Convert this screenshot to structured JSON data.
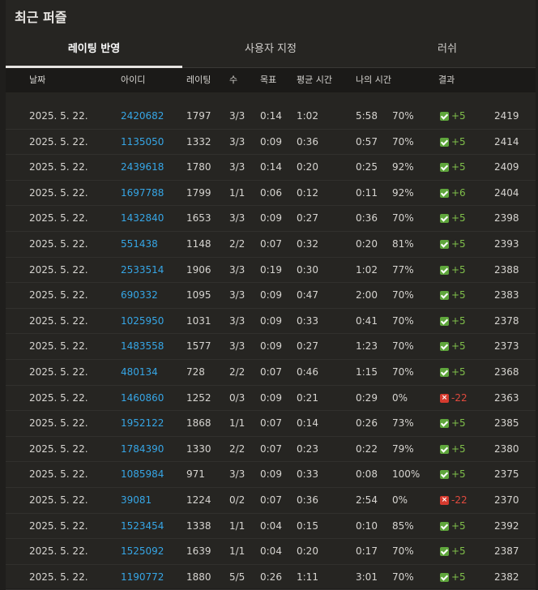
{
  "page": {
    "title": "최근 퍼즐"
  },
  "tabs": [
    {
      "label": "레이팅 반영",
      "active": true
    },
    {
      "label": "사용자 지정",
      "active": false
    },
    {
      "label": "러쉬",
      "active": false
    }
  ],
  "columns": [
    "날짜",
    "아이디",
    "레이팅",
    "수",
    "목표",
    "평균 시간",
    "나의 시간",
    "결과"
  ],
  "colors": {
    "success": "#5fa63c",
    "fail": "#d63b2f",
    "link": "#36a6e6"
  },
  "rows": [
    {
      "date": "2025. 5. 22.",
      "id": "2420682",
      "rating": "1797",
      "moves": "3/3",
      "goal": "0:14",
      "avg": "1:02",
      "mine": "5:58",
      "accuracy": "70%",
      "passed": true,
      "delta": "+5",
      "score": "2419"
    },
    {
      "date": "2025. 5. 22.",
      "id": "1135050",
      "rating": "1332",
      "moves": "3/3",
      "goal": "0:09",
      "avg": "0:36",
      "mine": "0:57",
      "accuracy": "70%",
      "passed": true,
      "delta": "+5",
      "score": "2414"
    },
    {
      "date": "2025. 5. 22.",
      "id": "2439618",
      "rating": "1780",
      "moves": "3/3",
      "goal": "0:14",
      "avg": "0:20",
      "mine": "0:25",
      "accuracy": "92%",
      "passed": true,
      "delta": "+5",
      "score": "2409"
    },
    {
      "date": "2025. 5. 22.",
      "id": "1697788",
      "rating": "1799",
      "moves": "1/1",
      "goal": "0:06",
      "avg": "0:12",
      "mine": "0:11",
      "accuracy": "92%",
      "passed": true,
      "delta": "+6",
      "score": "2404"
    },
    {
      "date": "2025. 5. 22.",
      "id": "1432840",
      "rating": "1653",
      "moves": "3/3",
      "goal": "0:09",
      "avg": "0:27",
      "mine": "0:36",
      "accuracy": "70%",
      "passed": true,
      "delta": "+5",
      "score": "2398"
    },
    {
      "date": "2025. 5. 22.",
      "id": "551438",
      "rating": "1148",
      "moves": "2/2",
      "goal": "0:07",
      "avg": "0:32",
      "mine": "0:20",
      "accuracy": "81%",
      "passed": true,
      "delta": "+5",
      "score": "2393"
    },
    {
      "date": "2025. 5. 22.",
      "id": "2533514",
      "rating": "1906",
      "moves": "3/3",
      "goal": "0:19",
      "avg": "0:30",
      "mine": "1:02",
      "accuracy": "77%",
      "passed": true,
      "delta": "+5",
      "score": "2388"
    },
    {
      "date": "2025. 5. 22.",
      "id": "690332",
      "rating": "1095",
      "moves": "3/3",
      "goal": "0:09",
      "avg": "0:47",
      "mine": "2:00",
      "accuracy": "70%",
      "passed": true,
      "delta": "+5",
      "score": "2383"
    },
    {
      "date": "2025. 5. 22.",
      "id": "1025950",
      "rating": "1031",
      "moves": "3/3",
      "goal": "0:09",
      "avg": "0:33",
      "mine": "0:41",
      "accuracy": "70%",
      "passed": true,
      "delta": "+5",
      "score": "2378"
    },
    {
      "date": "2025. 5. 22.",
      "id": "1483558",
      "rating": "1577",
      "moves": "3/3",
      "goal": "0:09",
      "avg": "0:27",
      "mine": "1:23",
      "accuracy": "70%",
      "passed": true,
      "delta": "+5",
      "score": "2373"
    },
    {
      "date": "2025. 5. 22.",
      "id": "480134",
      "rating": "728",
      "moves": "2/2",
      "goal": "0:07",
      "avg": "0:46",
      "mine": "1:15",
      "accuracy": "70%",
      "passed": true,
      "delta": "+5",
      "score": "2368"
    },
    {
      "date": "2025. 5. 22.",
      "id": "1460860",
      "rating": "1252",
      "moves": "0/3",
      "goal": "0:09",
      "avg": "0:21",
      "mine": "0:29",
      "accuracy": "0%",
      "passed": false,
      "delta": "-22",
      "score": "2363"
    },
    {
      "date": "2025. 5. 22.",
      "id": "1952122",
      "rating": "1868",
      "moves": "1/1",
      "goal": "0:07",
      "avg": "0:14",
      "mine": "0:26",
      "accuracy": "73%",
      "passed": true,
      "delta": "+5",
      "score": "2385"
    },
    {
      "date": "2025. 5. 22.",
      "id": "1784390",
      "rating": "1330",
      "moves": "2/2",
      "goal": "0:07",
      "avg": "0:23",
      "mine": "0:22",
      "accuracy": "79%",
      "passed": true,
      "delta": "+5",
      "score": "2380"
    },
    {
      "date": "2025. 5. 22.",
      "id": "1085984",
      "rating": "971",
      "moves": "3/3",
      "goal": "0:09",
      "avg": "0:33",
      "mine": "0:08",
      "accuracy": "100%",
      "passed": true,
      "delta": "+5",
      "score": "2375"
    },
    {
      "date": "2025. 5. 22.",
      "id": "39081",
      "rating": "1224",
      "moves": "0/2",
      "goal": "0:07",
      "avg": "0:36",
      "mine": "2:54",
      "accuracy": "0%",
      "passed": false,
      "delta": "-22",
      "score": "2370"
    },
    {
      "date": "2025. 5. 22.",
      "id": "1523454",
      "rating": "1338",
      "moves": "1/1",
      "goal": "0:04",
      "avg": "0:15",
      "mine": "0:10",
      "accuracy": "85%",
      "passed": true,
      "delta": "+5",
      "score": "2392"
    },
    {
      "date": "2025. 5. 22.",
      "id": "1525092",
      "rating": "1639",
      "moves": "1/1",
      "goal": "0:04",
      "avg": "0:20",
      "mine": "0:17",
      "accuracy": "70%",
      "passed": true,
      "delta": "+5",
      "score": "2387"
    },
    {
      "date": "2025. 5. 22.",
      "id": "1190772",
      "rating": "1880",
      "moves": "5/5",
      "goal": "0:26",
      "avg": "1:11",
      "mine": "3:01",
      "accuracy": "70%",
      "passed": true,
      "delta": "+5",
      "score": "2382"
    }
  ]
}
